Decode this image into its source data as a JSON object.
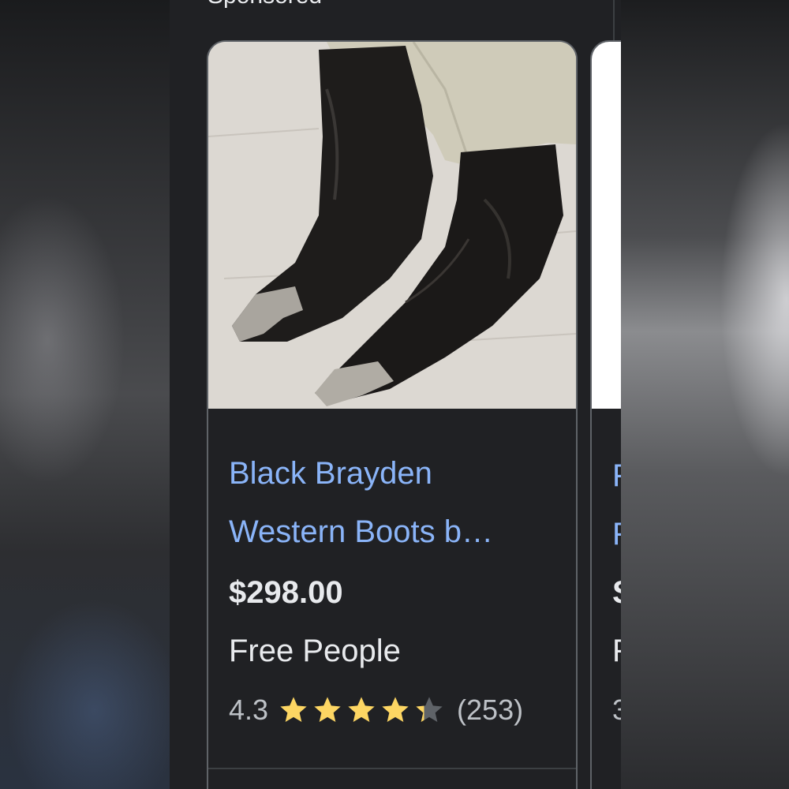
{
  "section": {
    "title": "Sponsored"
  },
  "product": {
    "title_line1": "Black Brayden",
    "title_line2": "Western Boots b…",
    "price": "$298.00",
    "merchant": "Free People",
    "rating": "4.3",
    "rating_value": 4.3,
    "rating_max": 5,
    "review_count": "(253)",
    "image_icon": "boots-photo",
    "colors": {
      "title": "#8ab4f8",
      "star": "#fdd663",
      "star_empty": "#5f6368"
    }
  },
  "next_product": {
    "title_line1": "F",
    "title_line2": "F",
    "price": "S",
    "merchant": "F",
    "rating": "3"
  }
}
